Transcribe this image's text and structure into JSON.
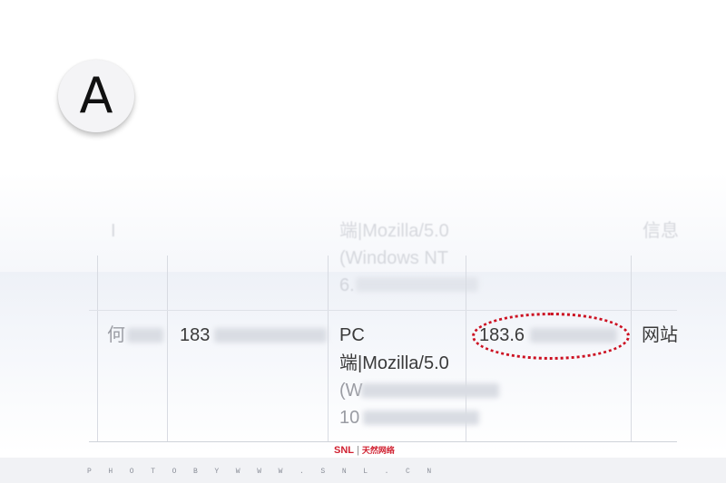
{
  "badge": {
    "letter": "A"
  },
  "table": {
    "header_row": {
      "col1": "I",
      "col3_lines": [
        "端|Mozilla/5.0",
        "(Windows NT",
        "6."
      ],
      "col5": "信息"
    },
    "data_row": {
      "col1": "何",
      "col2": "183",
      "col3_lines": [
        "PC",
        "端|Mozilla/5.0",
        "(W",
        "10"
      ],
      "col4": "183.6",
      "col5": "网站"
    }
  },
  "highlight": {
    "color": "#cc1122"
  },
  "footer": {
    "logo_brand": "SNL",
    "logo_cn": "天然网络",
    "watermark": "P H O T O   B Y   W W W . S N L . C N"
  }
}
